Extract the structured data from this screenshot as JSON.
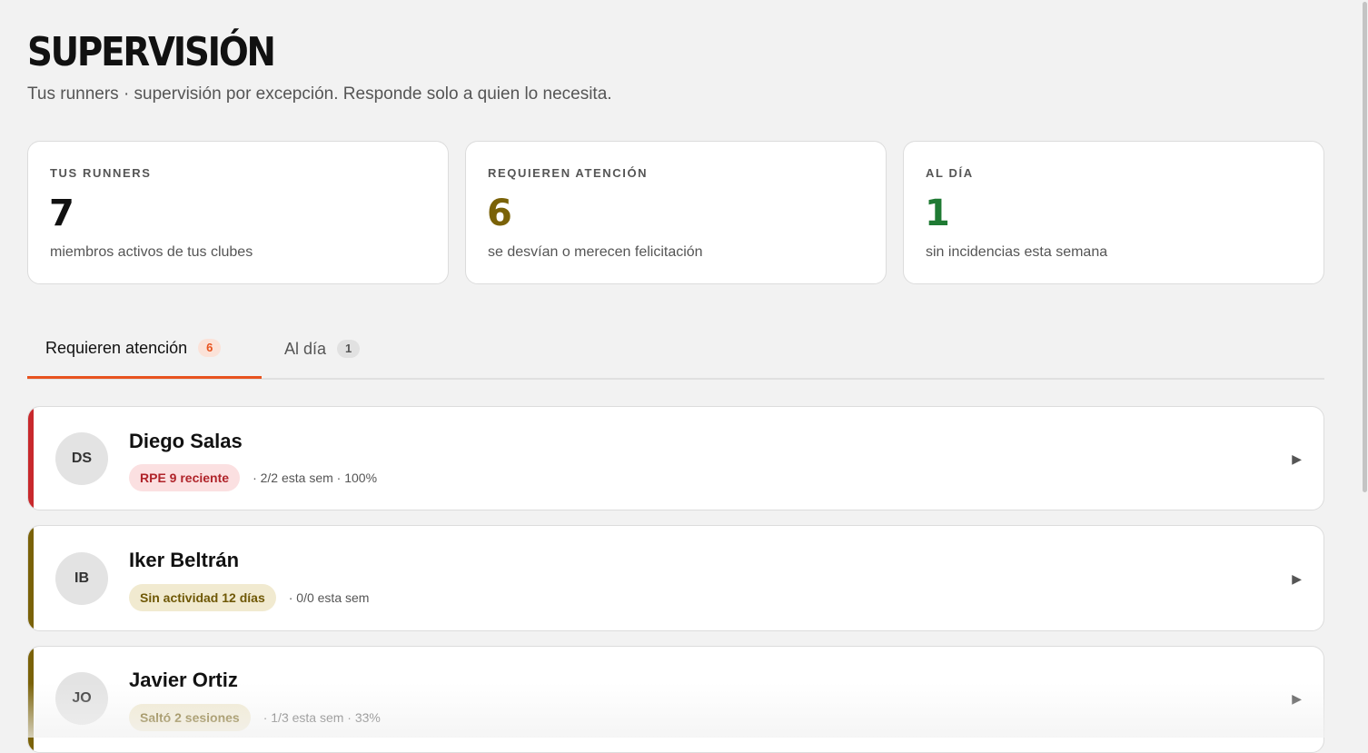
{
  "header": {
    "title": "SUPERVISIÓN",
    "subtitle": "Tus runners · supervisión por excepción. Responde solo a quien lo necesita."
  },
  "stats": [
    {
      "label": "TUS RUNNERS",
      "value": "7",
      "desc": "miembros activos de tus clubes",
      "color": "#111111"
    },
    {
      "label": "REQUIEREN ATENCIÓN",
      "value": "6",
      "desc": "se desvían o merecen felicitación",
      "color": "#7a6208"
    },
    {
      "label": "AL DÍA",
      "value": "1",
      "desc": "sin incidencias esta semana",
      "color": "#1f7a33"
    }
  ],
  "tabs": [
    {
      "label": "Requieren atención",
      "count": "6",
      "active": true
    },
    {
      "label": "Al día",
      "count": "1",
      "active": false
    }
  ],
  "runners": [
    {
      "initials": "DS",
      "name": "Diego Salas",
      "tag": "RPE 9 reciente",
      "stats": "· 2/2 esta sem · 100%",
      "accent": "#c8282c",
      "tag_bg": "#fbe0e1",
      "tag_color": "#b0242a",
      "chevron": "▶"
    },
    {
      "initials": "IB",
      "name": "Iker Beltrán",
      "tag": "Sin actividad 12 días",
      "stats": "· 0/0 esta sem",
      "accent": "#7a6208",
      "tag_bg": "#f1ead0",
      "tag_color": "#6f5806",
      "chevron": "▶"
    },
    {
      "initials": "JO",
      "name": "Javier Ortiz",
      "tag": "Saltó 2 sesiones",
      "stats": "· 1/3 esta sem · 33%",
      "accent": "#7a6208",
      "tag_bg": "#f1ead0",
      "tag_color": "#6f5806",
      "chevron": "▶"
    }
  ]
}
